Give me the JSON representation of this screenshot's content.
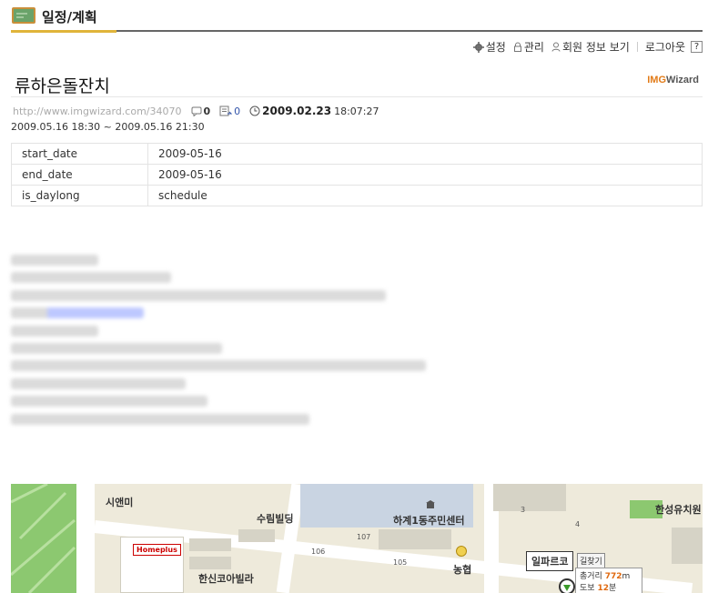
{
  "header": {
    "title": "일정/계획"
  },
  "toplinks": {
    "settings": "설정",
    "manage": "관리",
    "member_info": "회원 정보 보기",
    "logout": "로그아웃",
    "help": "?"
  },
  "post": {
    "title": "류하은돌잔치",
    "brand_a": "IMG",
    "brand_b": "Wizard",
    "url": "http://www.imgwizard.com/34070",
    "comment_count": "0",
    "trackback_count": "0",
    "date": "2009.02.23",
    "time": "18:07:27",
    "range": "2009.05.16 18:30 ~ 2009.05.16 21:30"
  },
  "props": [
    {
      "key": "start_date",
      "value": "2009-05-16"
    },
    {
      "key": "end_date",
      "value": "2009-05-16"
    },
    {
      "key": "is_daylong",
      "value": "schedule"
    }
  ],
  "map": {
    "labels": {
      "simanmi": "시앤미",
      "surim": "수림빌딩",
      "hagye": "하계1동주민센터",
      "hanseong": "한성유치원",
      "homeplus": "Homeplus",
      "hanshin": "한신코아빌라",
      "nonghyup": "농협",
      "ilparko": "일파르코",
      "find": "길찾기",
      "total_distance_label": "총거리",
      "total_distance_value": "772",
      "total_distance_unit": "m",
      "walk_label": "도보",
      "walk_value": "12",
      "walk_unit": "분",
      "num_106": "106",
      "num_107": "107",
      "num_105": "105",
      "num_3": "3",
      "num_4": "4"
    }
  },
  "colors": {
    "accent": "#e0b43a",
    "brand": "#e27b18",
    "link": "#3355aa"
  }
}
